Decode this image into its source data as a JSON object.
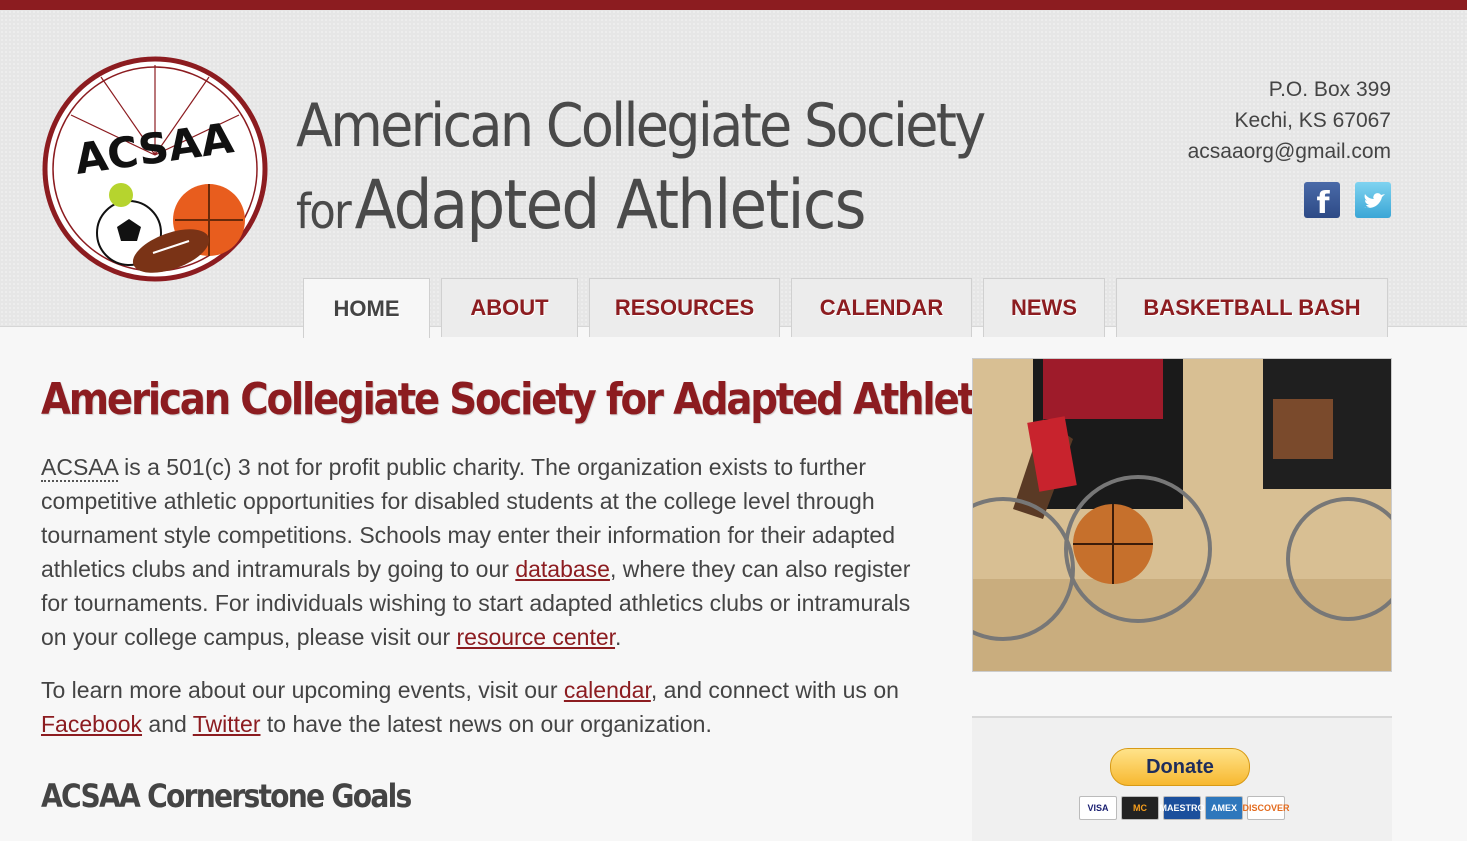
{
  "site": {
    "logo_text": "ACSAA",
    "title_line1": "American Collegiate Society",
    "title_for": "for",
    "title_line2": "Adapted Athletics"
  },
  "contact": {
    "po_box": "P.O. Box 399",
    "city": "Kechi, KS 67067",
    "email": "acsaaorg@gmail.com"
  },
  "social": {
    "facebook_icon": "f",
    "twitter_icon": "twitter-bird"
  },
  "nav": [
    {
      "label": "HOME",
      "active": true
    },
    {
      "label": "ABOUT",
      "active": false
    },
    {
      "label": "RESOURCES",
      "active": false
    },
    {
      "label": "CALENDAR",
      "active": false
    },
    {
      "label": "NEWS",
      "active": false
    },
    {
      "label": "BASKETBALL BASH",
      "active": false
    }
  ],
  "main": {
    "heading": "American Collegiate Society for Adapted Athletics",
    "p1": {
      "abbr": "ACSAA",
      "t1": " is a 501(c) 3 not for profit public charity. The organization exists to further competitive athletic opportunities for disabled students at the college level through tournament style competitions. Schools may enter their information for their adapted athletics clubs and intramurals by going to our ",
      "link1": "database",
      "t2": ", where they can also register for tournaments. For individuals wishing to start adapted athletics clubs or intramurals on your college campus, please visit our ",
      "link2": "resource center",
      "t3": "."
    },
    "p2": {
      "t1": "To learn more about our upcoming events, visit our ",
      "link1": "calendar",
      "t2": ", and connect with us on ",
      "link2": "Facebook",
      "t3": " and ",
      "link3": "Twitter",
      "t4": " to have the latest news on our organization."
    },
    "subheading": "ACSAA Cornerstone Goals"
  },
  "sidebar": {
    "donate_label": "Donate",
    "cards": [
      "VISA",
      "MC",
      "MAESTRO",
      "AMEX",
      "DISCOVER"
    ]
  },
  "colors": {
    "brand": "#8c1c20",
    "text": "#444444",
    "background": "#f7f7f7"
  }
}
